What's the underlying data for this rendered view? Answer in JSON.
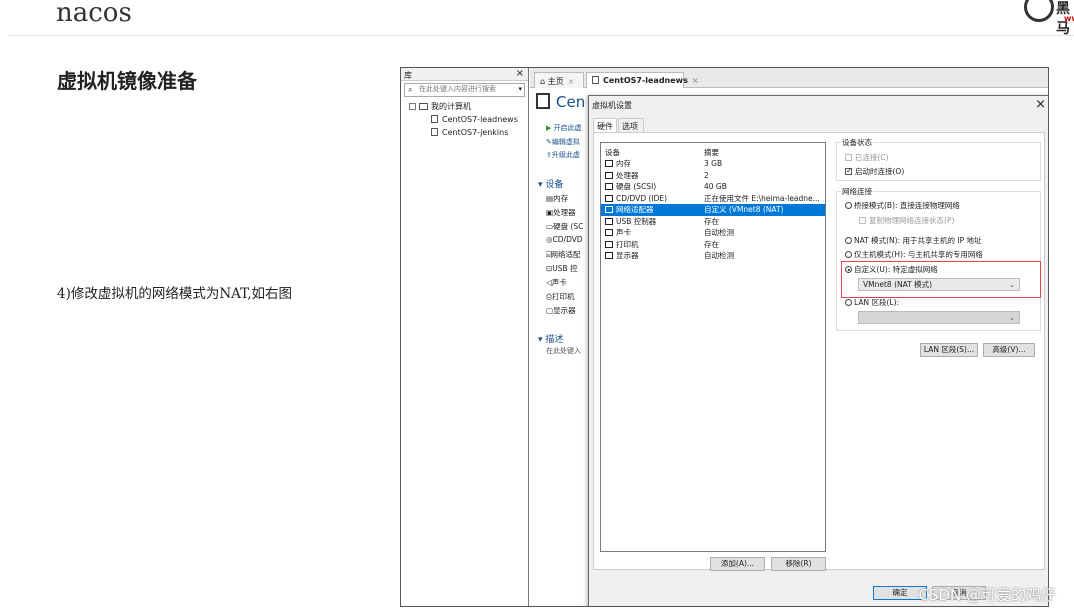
{
  "slide": {
    "title": "nacos",
    "logo_text": "黑马",
    "logo_www": "www.",
    "section_title": "虚拟机镜像准备",
    "step_text": "4)修改虚拟机的网络模式为NAT,如右图",
    "watermark": "CSDN @可爱的鸡仔"
  },
  "library": {
    "title": "库",
    "close": "×",
    "search_placeholder": "在此处键入内容进行搜索",
    "root": "我的计算机",
    "vms": [
      "CentOS7-leadnews",
      "CentOS7-jenkins"
    ]
  },
  "tabs": [
    {
      "label": "主页",
      "close": "×"
    },
    {
      "label": "CentOS7-leadnews",
      "close": "×"
    }
  ],
  "vm_panel": {
    "title": "Cen",
    "actions": [
      "开启此虚",
      "编辑虚拟",
      "升级此虚"
    ],
    "devices_header": "设备",
    "devices": [
      "内存",
      "处理器",
      "硬盘 (SC",
      "CD/DVD",
      "网络适配",
      "USB 控",
      "声卡",
      "打印机",
      "显示器"
    ],
    "description_header": "描述",
    "description_placeholder": "在此处键入"
  },
  "dialog": {
    "title": "虚拟机设置",
    "close": "×",
    "tabs": [
      "硬件",
      "选项"
    ],
    "device_col": "设备",
    "summary_col": "摘要",
    "devices": [
      {
        "name": "内存",
        "summary": "3 GB",
        "selected": false
      },
      {
        "name": "处理器",
        "summary": "2",
        "selected": false
      },
      {
        "name": "硬盘 (SCSI)",
        "summary": "40 GB",
        "selected": false
      },
      {
        "name": "CD/DVD (IDE)",
        "summary": "正在使用文件 E:\\heima-leadne...",
        "selected": false
      },
      {
        "name": "网络适配器",
        "summary": "自定义 (VMnet8 (NAT)",
        "selected": true
      },
      {
        "name": "USB 控制器",
        "summary": "存在",
        "selected": false
      },
      {
        "name": "声卡",
        "summary": "自动检测",
        "selected": false
      },
      {
        "name": "打印机",
        "summary": "存在",
        "selected": false
      },
      {
        "name": "显示器",
        "summary": "自动检测",
        "selected": false
      }
    ],
    "add_button": "添加(A)...",
    "remove_button": "移除(R)",
    "device_status": {
      "title": "设备状态",
      "connected": "已连接(C)",
      "connect_on_power": "启动时连接(O)"
    },
    "network": {
      "title": "网络连接",
      "bridged": "桥接模式(B): 直接连接物理网络",
      "replicate": "复制物理网络连接状态(P)",
      "nat": "NAT 模式(N): 用于共享主机的 IP 地址",
      "host_only": "仅主机模式(H): 与主机共享的专用网络",
      "custom": "自定义(U): 特定虚拟网络",
      "custom_value": "VMnet8 (NAT 模式)",
      "lan": "LAN 区段(L):",
      "lan_value": ""
    },
    "lan_button": "LAN 区段(S)...",
    "advanced_button": "高级(V)...",
    "ok_button": "确定",
    "cancel_button": "取消"
  }
}
